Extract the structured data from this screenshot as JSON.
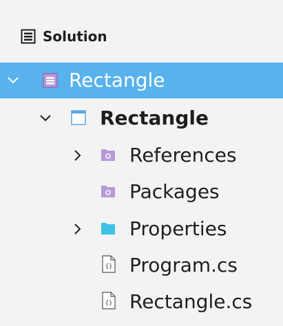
{
  "panel": {
    "title": "Solution",
    "title_icon": "solution-icon"
  },
  "tree": [
    {
      "label": "Rectangle",
      "icon": "solution-folder-icon",
      "expanded": true,
      "selected": true,
      "bold": false
    },
    {
      "label": "Rectangle",
      "icon": "project-icon",
      "expanded": true,
      "selected": false,
      "bold": true
    },
    {
      "label": "References",
      "icon": "references-folder-icon",
      "expanded": false,
      "selected": false,
      "bold": false
    },
    {
      "label": "Packages",
      "icon": "packages-folder-icon",
      "selected": false,
      "bold": false
    },
    {
      "label": "Properties",
      "icon": "folder-icon",
      "expanded": false,
      "selected": false,
      "bold": false
    },
    {
      "label": "Program.cs",
      "icon": "csharp-file-icon",
      "selected": false,
      "bold": false
    },
    {
      "label": "Rectangle.cs",
      "icon": "csharp-file-icon",
      "selected": false,
      "bold": false
    }
  ],
  "colors": {
    "selection": "#57b2ed",
    "folder_purple": "#b79ad8",
    "folder_blue": "#3fc1e6",
    "text": "#1e1e1e"
  }
}
